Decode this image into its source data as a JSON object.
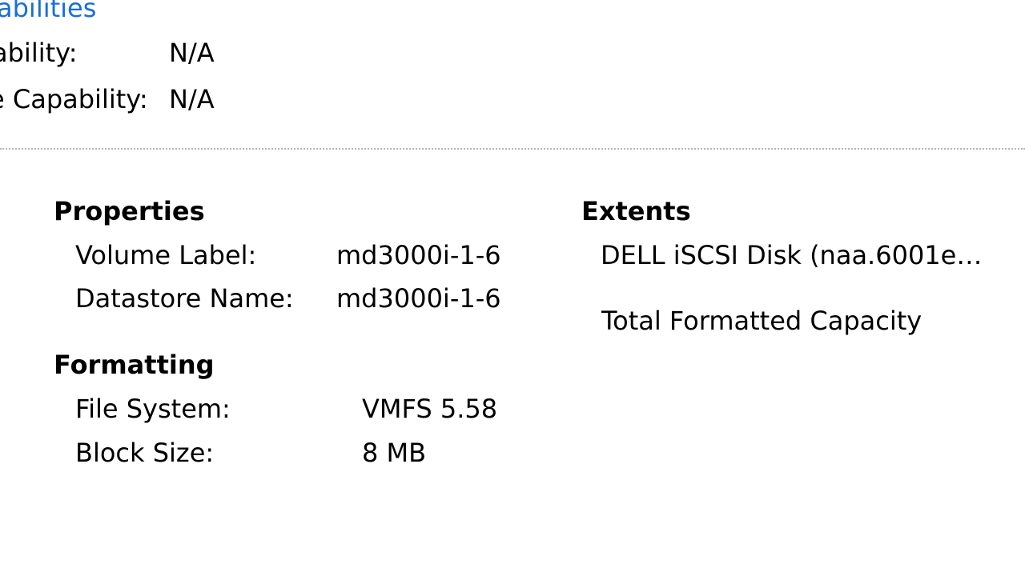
{
  "top": {
    "link_text": "abilities",
    "row1_label": "ability:",
    "row1_value": "N/A",
    "row2_label": "e Capability:",
    "row2_value": "N/A"
  },
  "properties": {
    "heading": "Properties",
    "volume_label_label": "Volume Label:",
    "volume_label_value": "md3000i-1-6",
    "datastore_name_label": "Datastore Name:",
    "datastore_name_value": "md3000i-1-6"
  },
  "formatting": {
    "heading": "Formatting",
    "file_system_label": "File System:",
    "file_system_value": "VMFS 5.58",
    "block_size_label": "Block Size:",
    "block_size_value": "8 MB"
  },
  "extents": {
    "heading": "Extents",
    "disk": "DELL iSCSI Disk (naa.6001e…",
    "total_capacity_label": "Total Formatted Capacity"
  },
  "colors": {
    "link": "#1a6fd6",
    "divider": "#b4b4b4"
  }
}
